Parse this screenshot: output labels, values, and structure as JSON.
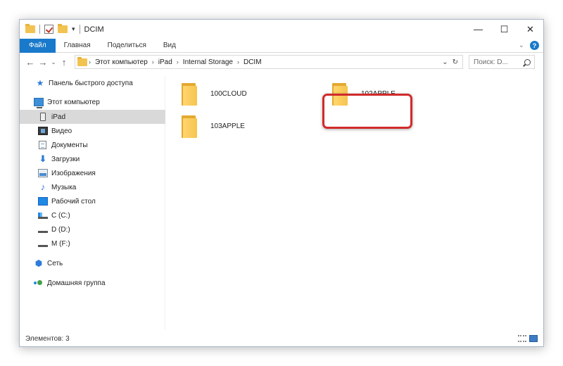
{
  "window": {
    "title": "DCIM",
    "qa_dropdown": "▾",
    "controls": {
      "minimize": "—",
      "maximize": "☐",
      "close": "✕"
    }
  },
  "ribbon": {
    "tabs": [
      "Файл",
      "Главная",
      "Поделиться",
      "Вид"
    ],
    "expand": "⌄",
    "help": "?"
  },
  "navigation": {
    "back": "←",
    "forward": "→",
    "recent": "⌄",
    "up": "↑"
  },
  "address": {
    "breadcrumbs": [
      "Этот компьютер",
      "iPad",
      "Internal Storage",
      "DCIM"
    ],
    "separator": "›",
    "dropdown": "⌄",
    "refresh": "↻"
  },
  "search": {
    "placeholder": "Поиск: D..."
  },
  "sidebar": {
    "items": [
      {
        "label": "Панель быстрого доступа",
        "icon": "star-icon"
      },
      {
        "label": "Этот компьютер",
        "icon": "computer-icon"
      },
      {
        "label": "iPad",
        "icon": "ipad-icon",
        "selected": true
      },
      {
        "label": "Видео",
        "icon": "video-icon"
      },
      {
        "label": "Документы",
        "icon": "documents-icon"
      },
      {
        "label": "Загрузки",
        "icon": "downloads-icon"
      },
      {
        "label": "Изображения",
        "icon": "pictures-icon"
      },
      {
        "label": "Музыка",
        "icon": "music-icon"
      },
      {
        "label": "Рабочий стол",
        "icon": "desktop-icon"
      },
      {
        "label": "C (C:)",
        "icon": "drive-c-icon"
      },
      {
        "label": "D (D:)",
        "icon": "drive-icon"
      },
      {
        "label": "M (F:)",
        "icon": "drive-icon"
      },
      {
        "label": "Сеть",
        "icon": "network-icon"
      },
      {
        "label": "Домашняя группа",
        "icon": "homegroup-icon"
      }
    ]
  },
  "folders": [
    {
      "name": "100CLOUD"
    },
    {
      "name": "102APPLE",
      "highlighted": true
    },
    {
      "name": "103APPLE"
    }
  ],
  "status": {
    "text": "Элементов: 3"
  },
  "colors": {
    "accent": "#1979ca",
    "highlight": "#d12b2b",
    "folder": "#f6c44f"
  }
}
